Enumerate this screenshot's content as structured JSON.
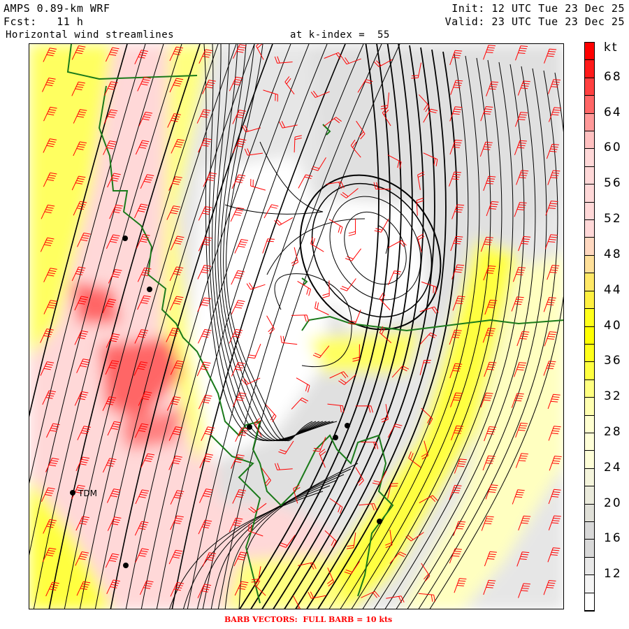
{
  "header": {
    "model": "AMPS 0.89-km WRF",
    "forecast": "Fcst:   11 h",
    "init": "Init: 12 UTC Tue 23 Dec 25",
    "valid": "Valid: 23 UTC Tue 23 Dec 25",
    "field": "Horizontal wind streamlines",
    "level": "at k-index =  55"
  },
  "map": {
    "station_label": "TDM",
    "colors": {
      "coast": "#1a7a1a",
      "barb": "#ff0000",
      "streamline": "#000000"
    }
  },
  "colorbar": {
    "unit": "kt",
    "labels": [
      "68",
      "64",
      "60",
      "56",
      "52",
      "48",
      "44",
      "40",
      "36",
      "32",
      "28",
      "24",
      "20",
      "16",
      "12"
    ],
    "colors": [
      "#ff0000",
      "#ff1a1a",
      "#ff4040",
      "#ff6666",
      "#ff9999",
      "#ffc0c0",
      "#ffd8d8",
      "#ffd8d8",
      "#ffd8d8",
      "#ffd8d8",
      "#ffd8d8",
      "#ffd8c0",
      "#ffe099",
      "#ffe866",
      "#fff040",
      "#ffff1a",
      "#ffff00",
      "#ffff1a",
      "#ffff40",
      "#ffff80",
      "#ffffb0",
      "#ffffd0",
      "#ffffd8",
      "#ffffd8",
      "#f5f5dc",
      "#ebebdc",
      "#e0e0d8",
      "#d8d8d8",
      "#d8d8d8",
      "#e8e8e8",
      "#f4f4f4",
      "#ffffff"
    ]
  },
  "footer": "BARB VECTORS:  FULL BARB = 10 kts"
}
